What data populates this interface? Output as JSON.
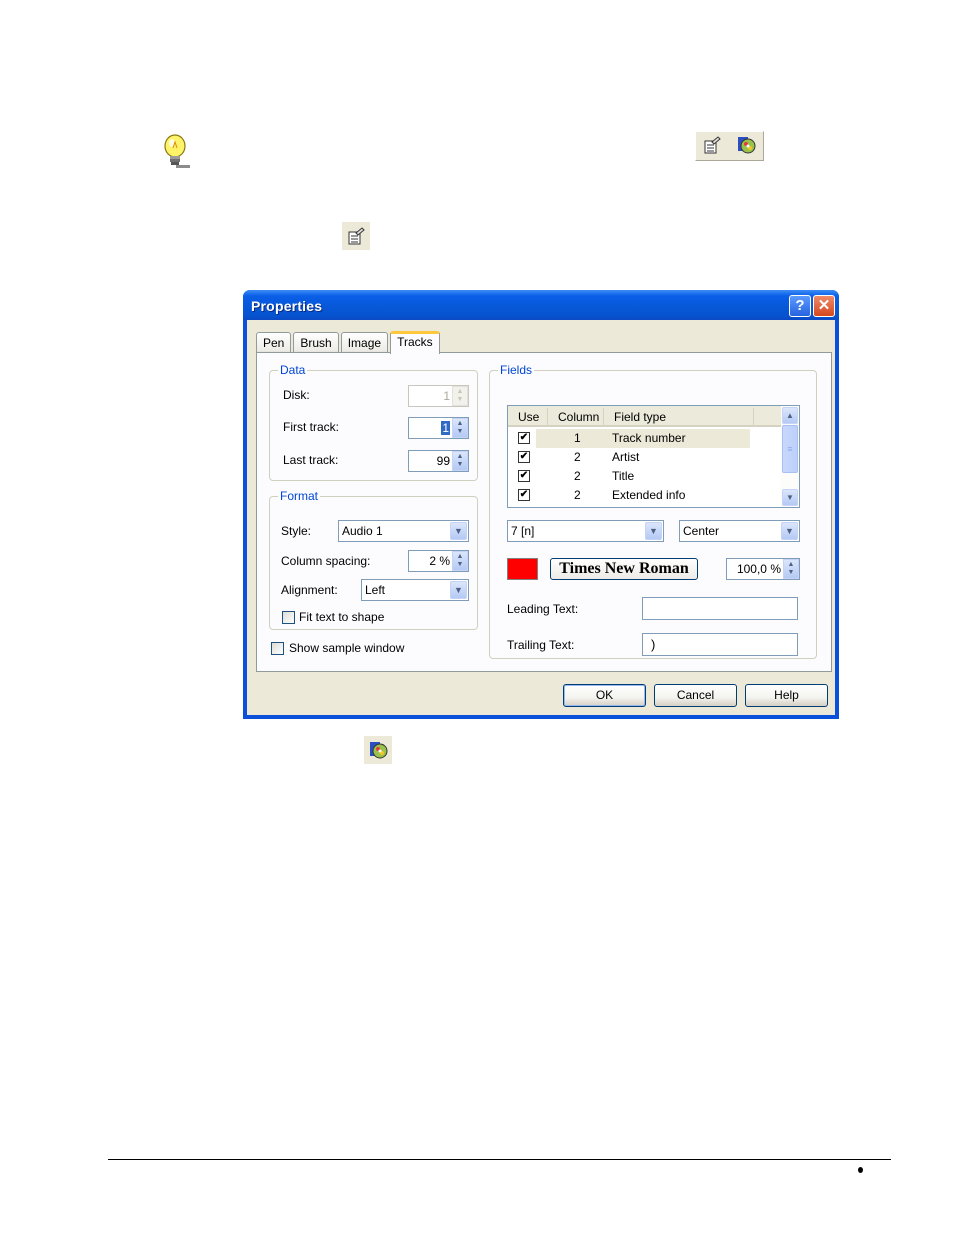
{
  "page": {
    "tip_icon": "lightbulb-icon",
    "toolbar_icons": [
      "properties-icon",
      "cd-cover-icon"
    ],
    "inline_icons": [
      "properties-icon",
      "cd-cover-icon"
    ]
  },
  "dialog": {
    "title": "Properties",
    "title_buttons": {
      "help": "?",
      "close": "✕"
    },
    "tabs": [
      {
        "label": "Pen",
        "active": false
      },
      {
        "label": "Brush",
        "active": false
      },
      {
        "label": "Image",
        "active": false
      },
      {
        "label": "Tracks",
        "active": true
      }
    ],
    "data_group": {
      "legend": "Data",
      "disk_label": "Disk:",
      "disk_value": "1",
      "first_track_label": "First track:",
      "first_track_value": "1",
      "last_track_label": "Last track:",
      "last_track_value": "99"
    },
    "format_group": {
      "legend": "Format",
      "style_label": "Style:",
      "style_value": "Audio 1",
      "column_spacing_label": "Column spacing:",
      "column_spacing_value": "2 %",
      "alignment_label": "Alignment:",
      "alignment_value": "Left",
      "fit_text_label": "Fit text to shape",
      "fit_text_checked": false
    },
    "show_sample_label": "Show sample window",
    "show_sample_checked": false,
    "fields_group": {
      "legend": "Fields",
      "columns": [
        "Use",
        "Column",
        "Field type"
      ],
      "rows": [
        {
          "use": true,
          "column": "1",
          "field_type": "Track number",
          "selected": true
        },
        {
          "use": true,
          "column": "2",
          "field_type": "Artist",
          "selected": false
        },
        {
          "use": true,
          "column": "2",
          "field_type": "Title",
          "selected": false
        },
        {
          "use": true,
          "column": "2",
          "field_type": "Extended info",
          "selected": false
        }
      ],
      "number_format_value": "7 [n]",
      "align_value": "Center",
      "color": "#ff0000",
      "font_label": "Times New Roman",
      "size_value": "100,0 %",
      "leading_text_label": "Leading Text:",
      "leading_text_value": "",
      "trailing_text_label": "Trailing Text:",
      "trailing_text_value": ")"
    },
    "buttons": {
      "ok": "OK",
      "cancel": "Cancel",
      "help": "Help"
    }
  },
  "footer": {
    "bullet": "•"
  }
}
